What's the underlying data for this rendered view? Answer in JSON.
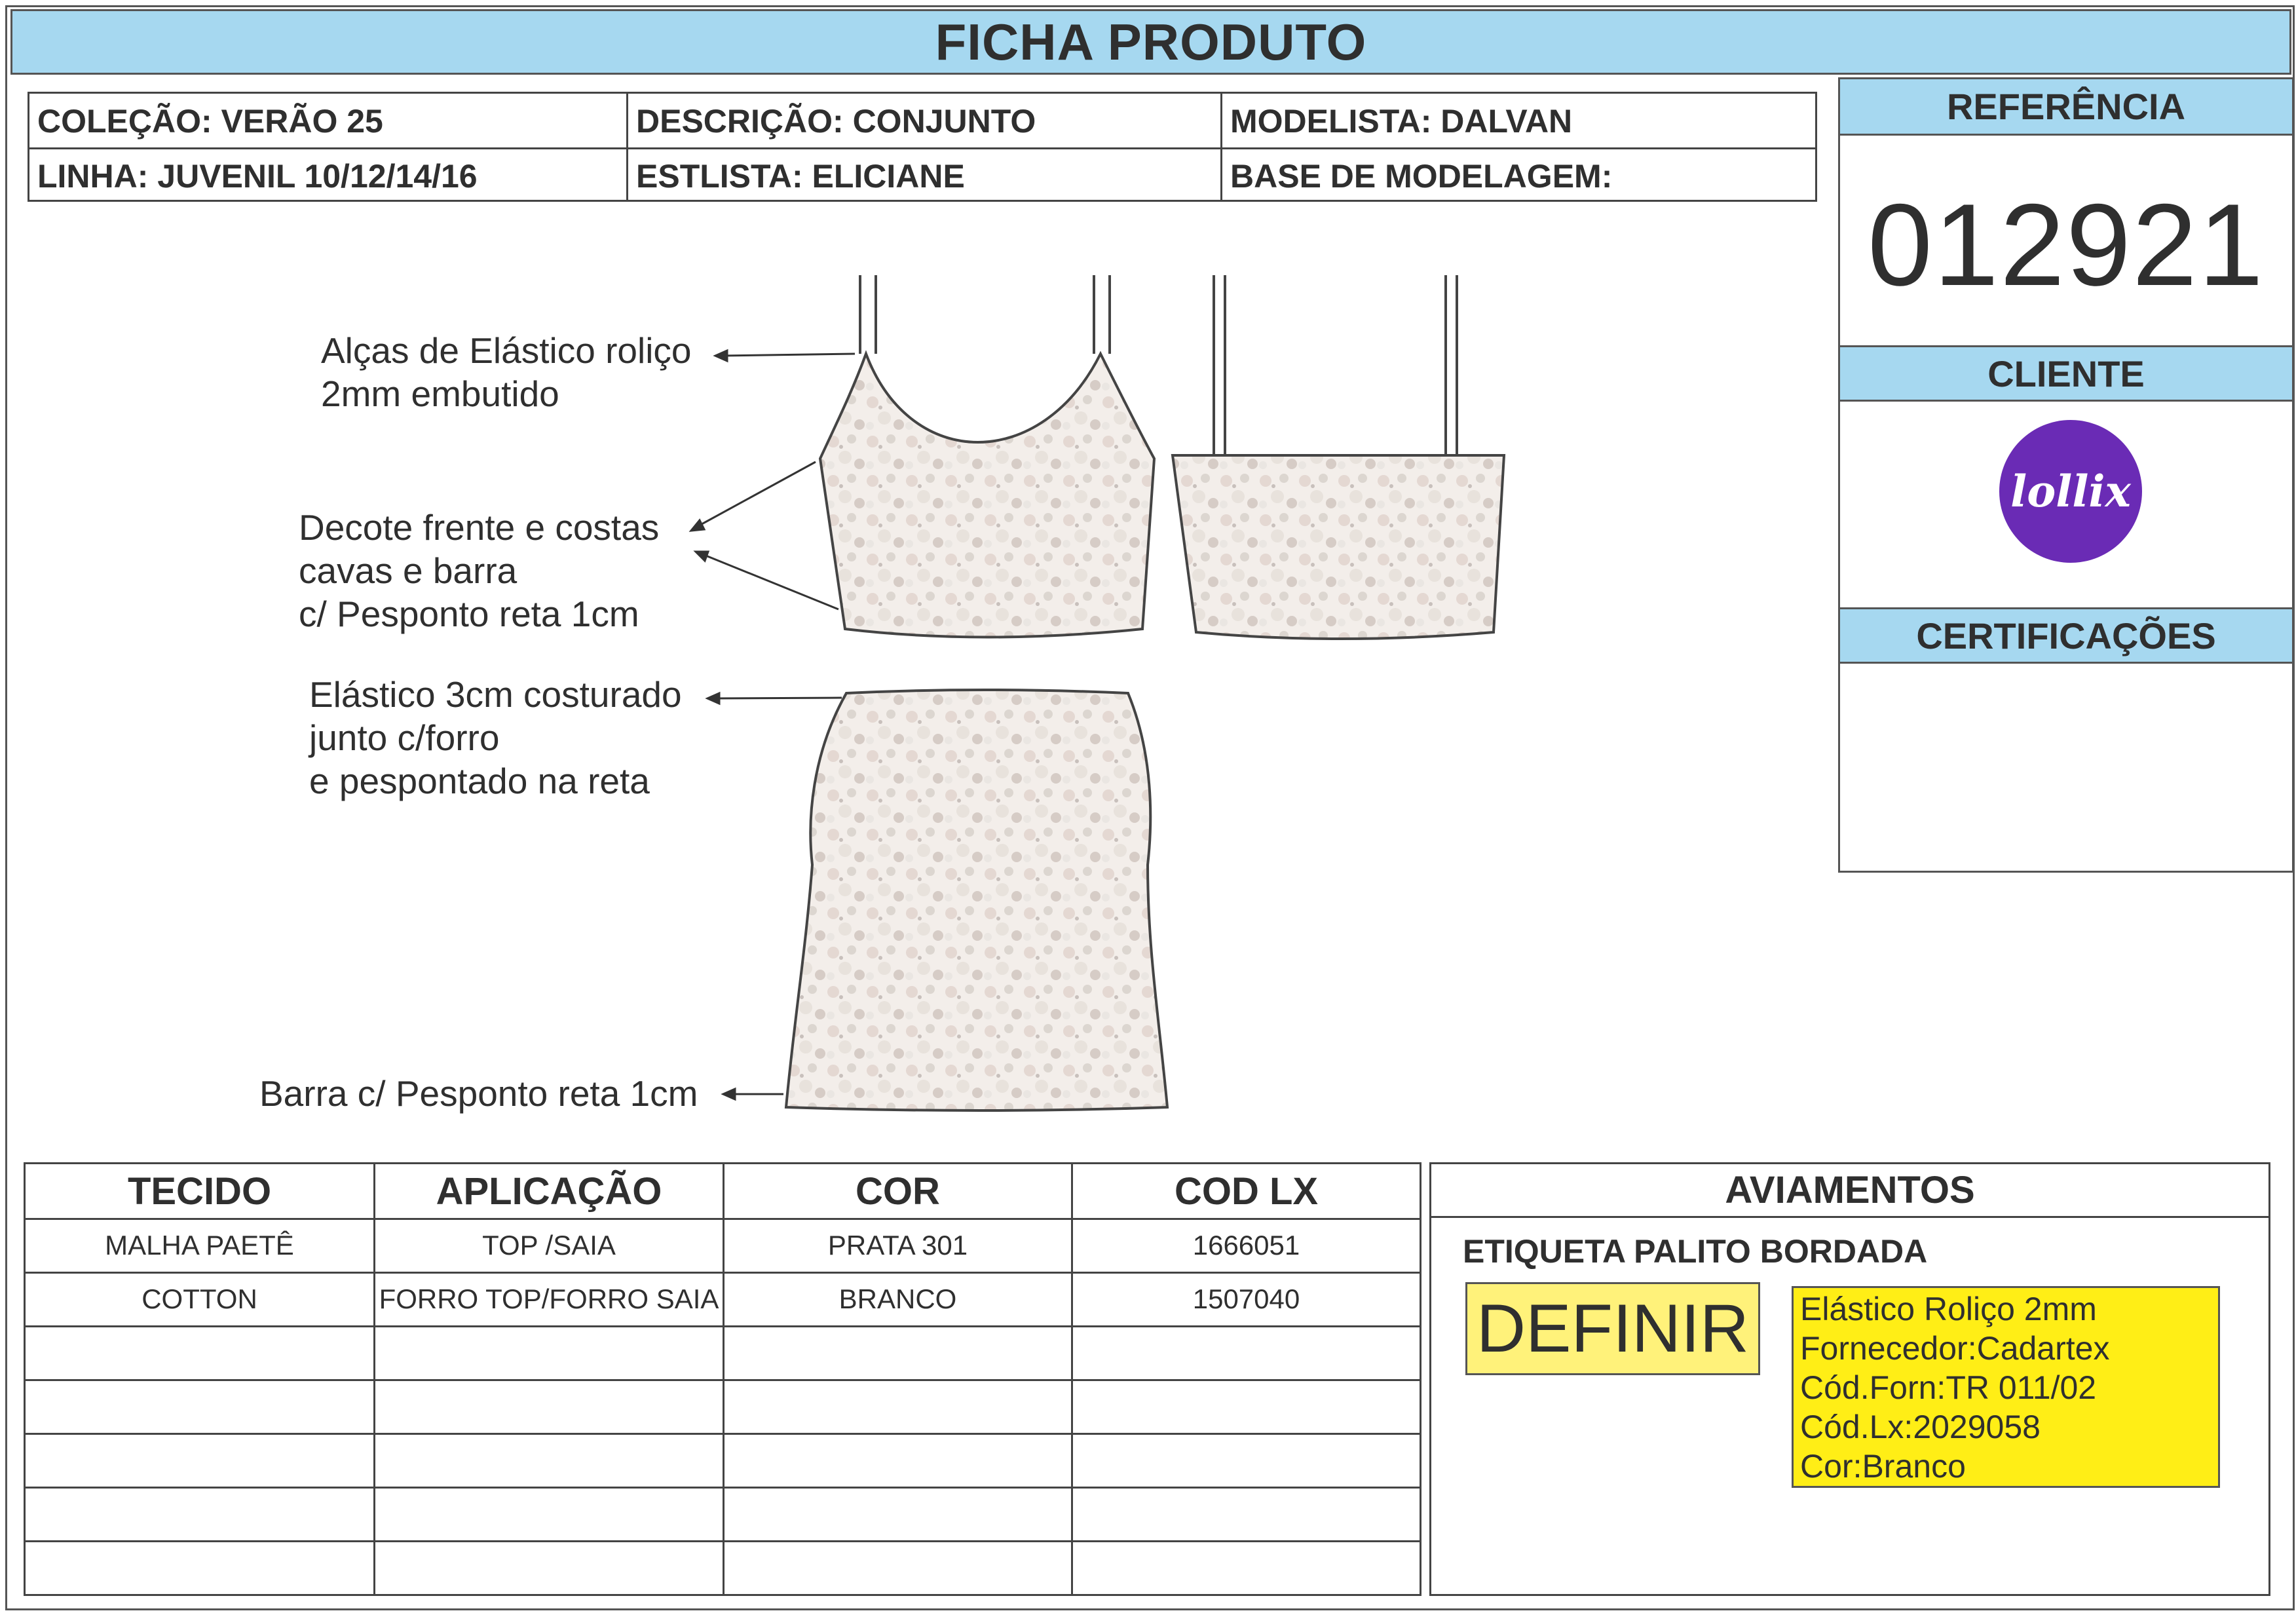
{
  "title": "FICHA PRODUTO",
  "info": {
    "colecao": "COLEÇÃO: VERÃO 25",
    "descricao": "DESCRIÇÃO: CONJUNTO",
    "modelista": "MODELISTA: DALVAN",
    "linha": "LINHA: JUVENIL 10/12/14/16",
    "estilista": "ESTLISTA: ELICIANE",
    "base": "BASE DE MODELAGEM:"
  },
  "sidebar": {
    "referencia_label": "REFERÊNCIA",
    "referencia_value": "012921",
    "cliente_label": "CLIENTE",
    "cliente_logo_text": "lollix",
    "certificacoes_label": "CERTIFICAÇÕES"
  },
  "annotations": {
    "alcas": "Alças de Elástico roliço\n2mm embutido",
    "decote": "Decote frente e costas\ncavas e barra\nc/ Pesponto reta 1cm",
    "elastico": "Elástico 3cm costurado\njunto c/forro\ne pespontado na reta",
    "barra": "Barra c/ Pesponto reta 1cm"
  },
  "table": {
    "headers": [
      "TECIDO",
      "APLICAÇÃO",
      "COR",
      "COD LX"
    ],
    "rows": [
      [
        "MALHA PAETÊ",
        "TOP /SAIA",
        "PRATA 301",
        "1666051"
      ],
      [
        "COTTON",
        "FORRO TOP/FORRO SAIA",
        "BRANCO",
        "1507040"
      ],
      [
        "",
        "",
        "",
        ""
      ],
      [
        "",
        "",
        "",
        ""
      ],
      [
        "",
        "",
        "",
        ""
      ],
      [
        "",
        "",
        "",
        ""
      ],
      [
        "",
        "",
        "",
        ""
      ]
    ]
  },
  "aviamentos": {
    "title": "AVIAMENTOS",
    "subtitle": "ETIQUETA PALITO BORDADA",
    "definir": "DEFINIR",
    "note_lines": [
      "Elástico Roliço 2mm",
      "Fornecedor:Cadartex",
      "Cód.Forn:TR 011/02",
      "Cód.Lx:2029058",
      "Cor:Branco"
    ]
  },
  "colors": {
    "header_blue": "#a6d8f0",
    "logo_purple": "#6a2bb5",
    "definir_yellow": "#fff27a",
    "note_yellow": "#ffee16"
  }
}
